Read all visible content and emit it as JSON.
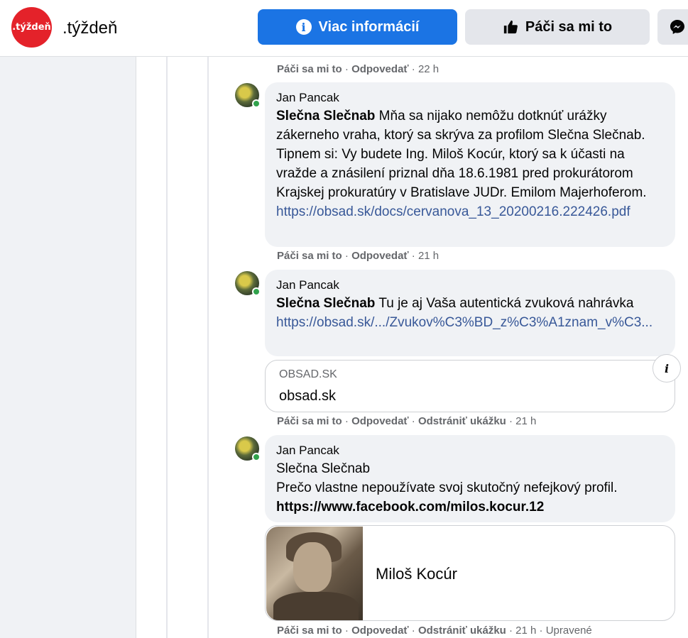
{
  "header": {
    "logo_text": ".týždeň",
    "page_name": ".týždeň",
    "more_info_label": "Viac informácií",
    "like_label": "Páči sa mi to",
    "accent": "#1b74e4"
  },
  "comments": [
    {
      "actions": {
        "like": "Páči sa mi to",
        "reply": "Odpovedať",
        "time": "22 h"
      }
    },
    {
      "author": "Jan Pancak",
      "tag": "Slečna Slečnab",
      "text": " Mňa sa nijako nemôžu dotknúť urážky zákerneho vraha, ktorý sa skrýva za profilom Slečna Slečnab. Tipnem si: Vy budete Ing. Miloš Kocúr, ktorý sa k účasti na vražde a znásilení priznal dňa 18.6.1981 pred prokurátorom Krajskej prokuratúry v Bratislave JUDr. Emilom Majerhoferom.",
      "link": "https://obsad.sk/docs/cervanova_13_20200216.222426.pdf",
      "actions": {
        "like": "Páči sa mi to",
        "reply": "Odpovedať",
        "time": "21 h"
      }
    },
    {
      "author": "Jan Pancak",
      "tag": "Slečna Slečnab",
      "text": " Tu je aj Vaša autentická zvuková nahrávka",
      "link": "https://obsad.sk/.../Zvukov%C3%BD_z%C3%A1znam_v%C3...",
      "preview": {
        "domain": "OBSAD.SK",
        "title": "obsad.sk"
      },
      "actions": {
        "like": "Páči sa mi to",
        "reply": "Odpovedať",
        "remove": "Odstrániť ukážku",
        "time": "21 h"
      }
    },
    {
      "author": "Jan Pancak",
      "tag": "Slečna Slečnab",
      "text": "Prečo vlastne nepoužívate svoj skutočný nefejkový profil.",
      "link": "https://www.facebook.com/milos.kocur.12",
      "preview": {
        "title": "Miloš Kocúr"
      },
      "actions": {
        "like": "Páči sa mi to",
        "reply": "Odpovedať",
        "remove": "Odstrániť ukážku",
        "time": "21 h",
        "edited": "Upravené"
      }
    }
  ]
}
